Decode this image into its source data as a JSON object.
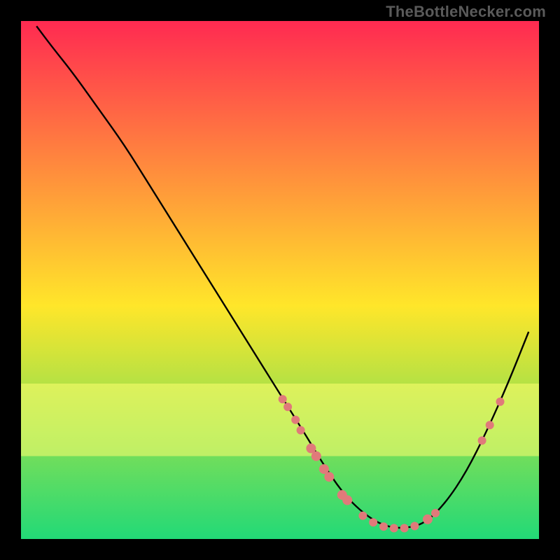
{
  "watermark": "TheBottleNecker.com",
  "chart_data": {
    "type": "line",
    "title": "",
    "xlabel": "",
    "ylabel": "",
    "xlim": [
      0,
      100
    ],
    "ylim": [
      0,
      100
    ],
    "grid": false,
    "background_gradient": {
      "top": "#ff2a51",
      "mid": "#ffe62a",
      "band": "#ffff70",
      "bottom": "#22d977"
    },
    "series": [
      {
        "name": "bottleneck-curve",
        "color": "#000000",
        "x": [
          3,
          6,
          10,
          15,
          20,
          25,
          30,
          35,
          40,
          45,
          50,
          55,
          58,
          62,
          66,
          70,
          74,
          78,
          82,
          86,
          90,
          94,
          98
        ],
        "y": [
          99,
          95,
          90,
          83,
          76,
          68,
          60,
          52,
          44,
          36,
          28,
          20,
          15,
          9,
          5,
          2.5,
          2,
          3,
          7,
          13,
          21,
          30,
          40
        ]
      }
    ],
    "markers": {
      "name": "highlighted-points",
      "color": "#e07a7a",
      "points": [
        {
          "x": 50.5,
          "y": 27.0,
          "r": 6
        },
        {
          "x": 51.5,
          "y": 25.5,
          "r": 6
        },
        {
          "x": 53.0,
          "y": 23.0,
          "r": 6
        },
        {
          "x": 54.0,
          "y": 21.0,
          "r": 6
        },
        {
          "x": 56.0,
          "y": 17.5,
          "r": 7
        },
        {
          "x": 57.0,
          "y": 16.0,
          "r": 7
        },
        {
          "x": 58.5,
          "y": 13.5,
          "r": 7
        },
        {
          "x": 59.5,
          "y": 12.0,
          "r": 7
        },
        {
          "x": 62.0,
          "y": 8.5,
          "r": 7
        },
        {
          "x": 63.0,
          "y": 7.5,
          "r": 7
        },
        {
          "x": 66.0,
          "y": 4.5,
          "r": 6
        },
        {
          "x": 68.0,
          "y": 3.2,
          "r": 6
        },
        {
          "x": 70.0,
          "y": 2.4,
          "r": 6
        },
        {
          "x": 72.0,
          "y": 2.1,
          "r": 6
        },
        {
          "x": 74.0,
          "y": 2.1,
          "r": 6
        },
        {
          "x": 76.0,
          "y": 2.5,
          "r": 6
        },
        {
          "x": 78.5,
          "y": 3.8,
          "r": 7
        },
        {
          "x": 80.0,
          "y": 5.0,
          "r": 6
        },
        {
          "x": 89.0,
          "y": 19.0,
          "r": 6
        },
        {
          "x": 90.5,
          "y": 22.0,
          "r": 6
        },
        {
          "x": 92.5,
          "y": 26.5,
          "r": 6
        }
      ]
    }
  }
}
